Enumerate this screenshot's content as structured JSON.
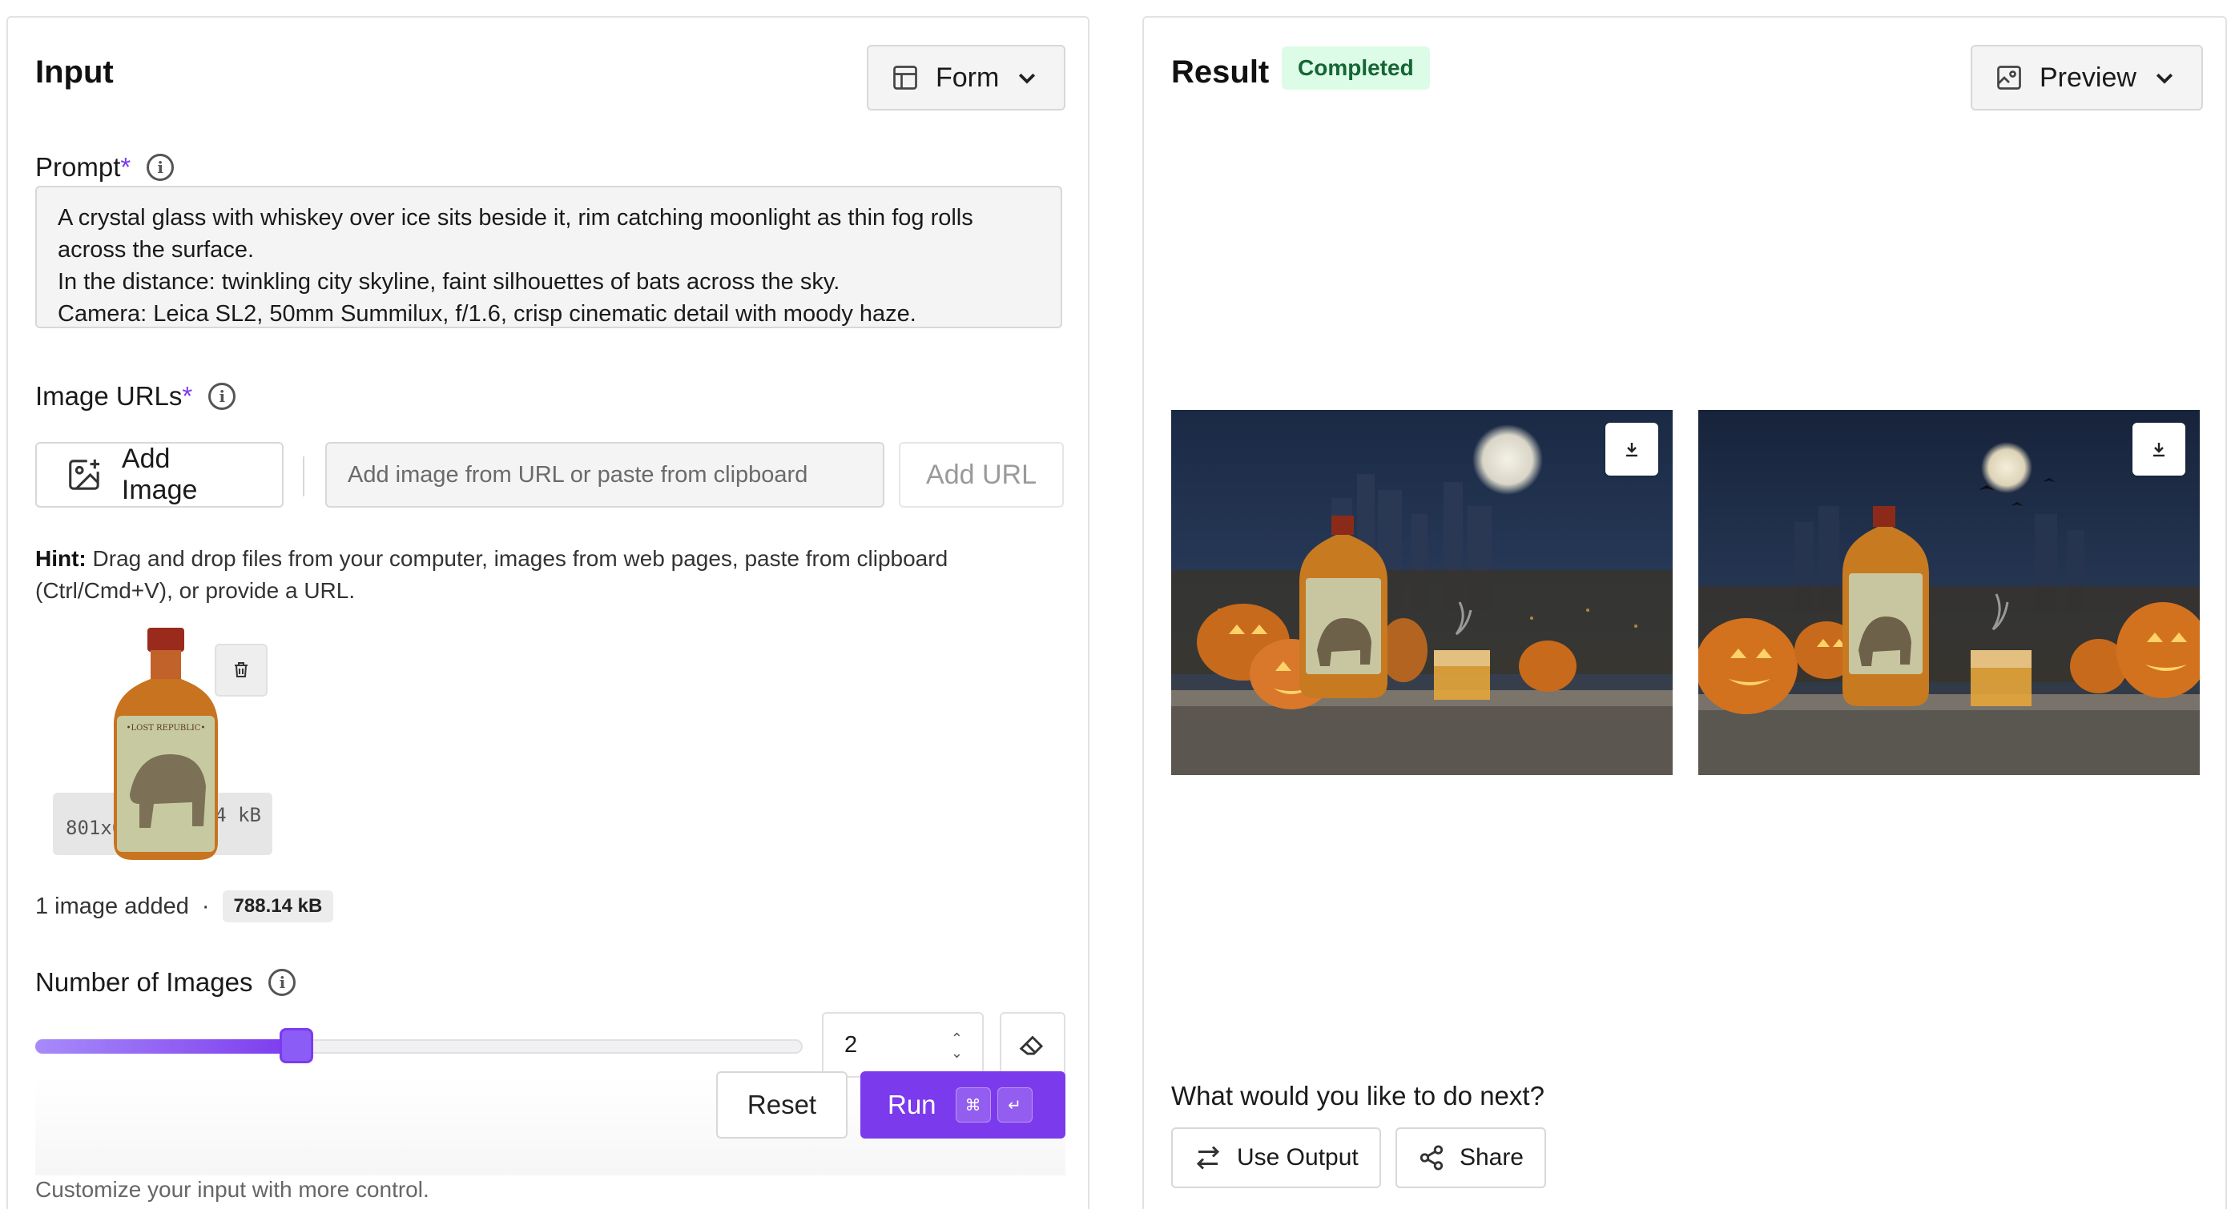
{
  "input": {
    "title": "Input",
    "view_mode": "Form",
    "prompt": {
      "label": "Prompt",
      "required_marker": "*",
      "text": "A crystal glass with whiskey over ice sits beside it, rim catching moonlight as thin fog rolls\nacross the surface.\nIn the distance: twinkling city skyline, faint silhouettes of bats across the sky.\nCamera: Leica SL2, 50mm Summilux, f/1.6, crisp cinematic detail with moody haze.\nPalette: rich oranges, deep blacks, warm amber candlelight, cool city night air."
    },
    "image_urls": {
      "label": "Image URLs",
      "required_marker": "*",
      "add_image_label": "Add Image",
      "url_placeholder": "Add image from URL or paste from clipboard",
      "add_url_label": "Add URL",
      "hint_bold": "Hint:",
      "hint_text": " Drag and drop files from your computer, images from web pages, paste from clipboard (Ctrl/Cmd+V), or provide a URL.",
      "thumbnail": {
        "dimensions": "801x601",
        "size": "788.14 kB"
      },
      "count_text": "1 image added",
      "separator": "·",
      "total_size": "788.14 kB"
    },
    "num_images": {
      "label": "Number of Images",
      "value": "2",
      "slider_fraction": 0.34
    },
    "reset_label": "Reset",
    "run_label": "Run",
    "run_kbd": [
      "⌘",
      "↵"
    ],
    "customize_text": "Customize your input with more control."
  },
  "result": {
    "title": "Result",
    "status": "Completed",
    "view_mode": "Preview",
    "next_question": "What would you like to do next?",
    "use_output_label": "Use Output",
    "share_label": "Share"
  },
  "colors": {
    "accent": "#7c3aed",
    "status_bg": "#dcfce7",
    "status_text": "#166534"
  }
}
